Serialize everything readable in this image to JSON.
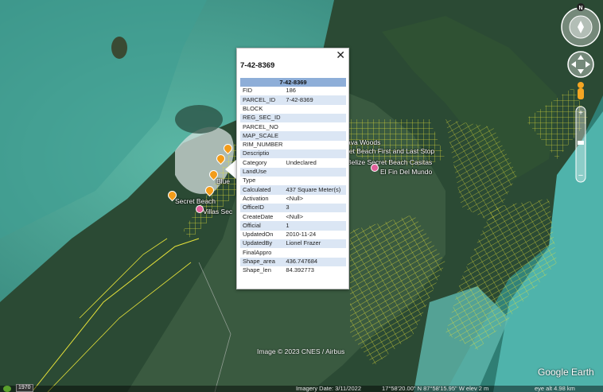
{
  "map": {
    "labels": {
      "secret_beach": "Secret Beach",
      "villas_sec": "Villas Sec",
      "blue": "Blue",
      "ava_woods": "ava Woods",
      "first_and_last": "ret Beach First and Last Stop",
      "casitas": "Belize Secret Beach Casitas",
      "del_mundo": "El Fin Del Mundo"
    },
    "credit": "Image © 2023 CNES / Airbus",
    "logo": "Google Earth"
  },
  "status": {
    "year": "1970",
    "imagery_date": "Imagery Date: 3/11/2022",
    "coords": "17°58'20.00\" N   87°58'15.95\" W   elev   2 m",
    "eye_alt": "eye alt   4.98 km"
  },
  "nav": {
    "north": "N"
  },
  "popup": {
    "title": "7-42-8369",
    "header": "7-42-8369",
    "close_icon": "close-icon",
    "rows": [
      {
        "key": "FID",
        "value": "186"
      },
      {
        "key": "PARCEL_ID",
        "value": "7-42-8369"
      },
      {
        "key": "BLOCK",
        "value": ""
      },
      {
        "key": "REG_SEC_ID",
        "value": ""
      },
      {
        "key": "PARCEL_NO",
        "value": ""
      },
      {
        "key": "MAP_SCALE",
        "value": ""
      },
      {
        "key": "RIM_NUMBER",
        "value": ""
      },
      {
        "key": "Descriptio",
        "value": ""
      },
      {
        "key": "Category",
        "value": "Undeclared"
      },
      {
        "key": "LandUse",
        "value": ""
      },
      {
        "key": "Type",
        "value": ""
      },
      {
        "key": "Calculated",
        "value": "437 Square Meter(s)"
      },
      {
        "key": "Activation",
        "value": "<Null>"
      },
      {
        "key": "OfficeID",
        "value": "3"
      },
      {
        "key": "CreateDate",
        "value": "<Null>"
      },
      {
        "key": "Official",
        "value": "1"
      },
      {
        "key": "UpdatedOn",
        "value": "2010-11-24"
      },
      {
        "key": "UpdatedBy",
        "value": "Lionel Frazer"
      },
      {
        "key": "FinalAppro",
        "value": ""
      },
      {
        "key": "Shape_area",
        "value": "436.747684"
      },
      {
        "key": "Shape_len",
        "value": "84.392773"
      }
    ]
  },
  "colors": {
    "water": "#3e9b8c",
    "land": "#27402e",
    "parcel": "#e6e23a",
    "table_header": "#8eaed8",
    "row_alt": "#dbe6f4"
  }
}
